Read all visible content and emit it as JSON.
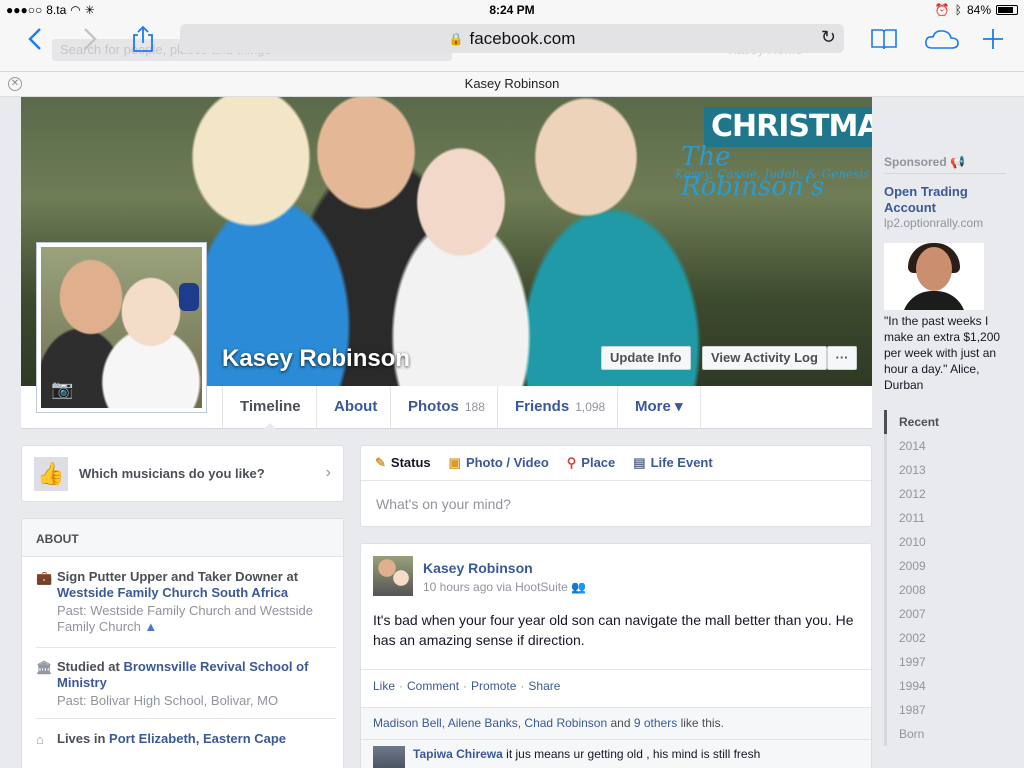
{
  "status_bar": {
    "carrier": "8.ta",
    "time": "8:24 PM",
    "battery": "84%",
    "battery_level": 0.84
  },
  "browser": {
    "url": "facebook.com",
    "page_title": "Kasey Robinson",
    "back_icon": "back-chevron-icon",
    "forward_icon": "forward-chevron-icon",
    "share_icon": "share-icon",
    "reload_icon": "reload-icon",
    "bookmarks_icon": "book-icon",
    "cloud_icon": "cloud-icon",
    "new_tab_icon": "plus-icon",
    "ghost_search": "Search for people, places and things",
    "ghost_nav": "Kasey   Home"
  },
  "cover": {
    "xmas_title": "CHRISTMAS",
    "xmas_script": "The Robinson's",
    "xmas_names": "Kasey, Cassie, Judah, & Genesis",
    "name": "Kasey Robinson",
    "update_info": "Update Info",
    "activity_log": "View Activity Log",
    "more_dots": "···"
  },
  "tabs": [
    {
      "label": "Timeline",
      "count": ""
    },
    {
      "label": "About",
      "count": ""
    },
    {
      "label": "Photos",
      "count": "188"
    },
    {
      "label": "Friends",
      "count": "1,098"
    },
    {
      "label": "More ▾",
      "count": ""
    }
  ],
  "music_prompt": "Which musicians do you like?",
  "about": {
    "heading": "ABOUT",
    "work_prefix": "Sign Putter Upper and Taker Downer at",
    "work_link": "Westside Family Church South Africa",
    "work_past": "Past: Westside Family Church and Westside Family Church",
    "study_prefix": "Studied at",
    "study_link": "Brownsville Revival School of Ministry",
    "study_past": "Past: Bolivar High School, Bolivar, MO",
    "lives_prefix": "Lives in",
    "lives_link": "Port Elizabeth, Eastern Cape"
  },
  "composer": {
    "status": "Status",
    "photo": "Photo / Video",
    "place": "Place",
    "life_event": "Life Event",
    "placeholder": "What's on your mind?"
  },
  "post": {
    "author": "Kasey Robinson",
    "meta": "10 hours ago via HootSuite",
    "body": "It's bad when your four year old son can navigate the mall better than you. He has an amazing sense if direction.",
    "like": "Like",
    "comment": "Comment",
    "promote": "Promote",
    "share": "Share",
    "likers": "Madison Bell, Ailene Banks, Chad Robinson",
    "likers_and": "and",
    "others": "9 others",
    "likes_suffix": "like this.",
    "comment_author": "Tapiwa Chirewa",
    "comment_text": "it jus means ur getting old , his mind is still fresh"
  },
  "sidebar": {
    "sponsored": "Sponsored",
    "ad_title": "Open Trading Account",
    "ad_domain": "lp2.optionrally.com",
    "ad_text": "\"In the past weeks I make an extra $1,200 per week with just an hour a day.\" Alice, Durban",
    "years": [
      "Recent",
      "2014",
      "2013",
      "2012",
      "2011",
      "2010",
      "2009",
      "2008",
      "2007",
      "2002",
      "1997",
      "1994",
      "1987",
      "Born"
    ]
  }
}
